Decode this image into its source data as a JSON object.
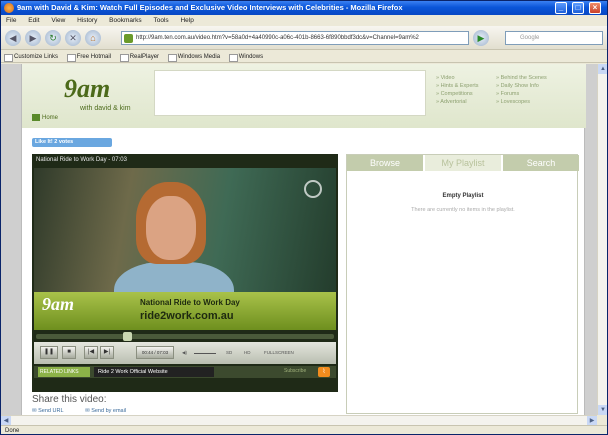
{
  "window": {
    "title": "9am with David & Kim: Watch Full Episodes and Exclusive Video Interviews with Celebrities - Mozilla Firefox"
  },
  "menu": [
    "File",
    "Edit",
    "View",
    "History",
    "Bookmarks",
    "Tools",
    "Help"
  ],
  "navbar": {
    "url": "http://9am.ten.com.au/video.htm?v=58a0d+4a40990c-a06c-401b-8663-6f890bbdf3dc&v=Channel=9am%2",
    "search_placeholder": "Google"
  },
  "bookmarks": [
    "Customize Links",
    "Free Hotmail",
    "RealPlayer",
    "Windows Media",
    "Windows"
  ],
  "site": {
    "logo": "9am",
    "logo_sub": "with david & kim",
    "home": "Home",
    "nav_col1": [
      "» Video",
      "» Hints & Experts",
      "» Competitions",
      "» Advertorial"
    ],
    "nav_col2": [
      "» Behind the Scenes",
      "» Daily Show Info",
      "» Forums",
      "» Lovescopes"
    ],
    "like_label": "Like It!  2 votes"
  },
  "player": {
    "title": "National Ride to Work Day - 07:03",
    "lower_third_logo": "9am",
    "lower_third_line1": "National Ride to Work Day",
    "lower_third_line2": "ride2work.com.au",
    "progress": 0.3,
    "time": "00:44 / 07:03",
    "quality_label": "SD",
    "quality_alt": "HD",
    "fullscreen_label": "FULLSCREEN",
    "related_label": "RELATED LINKS",
    "related_title": "Ride 2 Work Official Website",
    "subscribe_label": "Subscribe"
  },
  "share": {
    "heading": "Share this video:",
    "send_url": "Send URL",
    "send_email": "Send by email"
  },
  "panel": {
    "tabs": [
      "Browse",
      "My Playlist",
      "Search"
    ],
    "active_tab": "My Playlist",
    "empty_title": "Empty Playlist",
    "empty_message": "There are currently no items in the playlist."
  },
  "status": "Done"
}
